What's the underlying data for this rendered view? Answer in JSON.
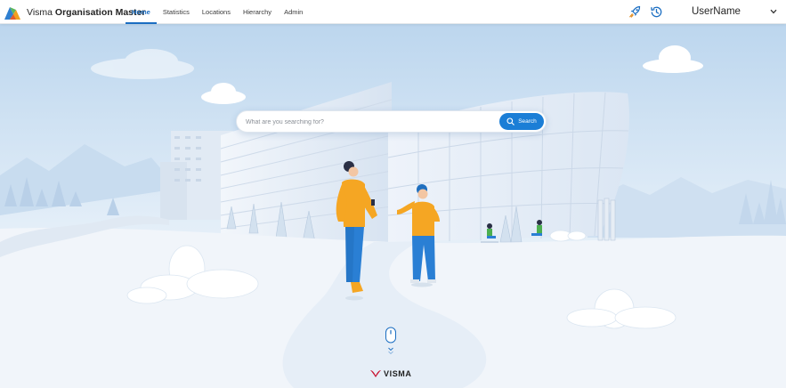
{
  "app": {
    "brand_light": "Visma",
    "brand_bold": "Organisation Master"
  },
  "nav": {
    "items": [
      {
        "label": "Home",
        "active": true
      },
      {
        "label": "Statistics",
        "active": false
      },
      {
        "label": "Locations",
        "active": false
      },
      {
        "label": "Hierarchy",
        "active": false
      },
      {
        "label": "Admin",
        "active": false
      }
    ]
  },
  "header": {
    "icons": [
      "rocket-icon",
      "history-clock-icon"
    ],
    "user_name": "UserName"
  },
  "search": {
    "placeholder": "What are you searching for?",
    "value": "",
    "button_label": "Search",
    "button_icon": "search-icon"
  },
  "footer": {
    "scroll_hint_icon": "mouse-scroll-icon",
    "logo_text": "VISMA"
  },
  "colors": {
    "accent": "#1b6ec2",
    "button": "#1b7ed6",
    "sky_top": "#bcd6ee",
    "logo_red": "#c8102e",
    "figure_shirt": "#f5a623",
    "figure_pants": "#2a7fd4"
  }
}
